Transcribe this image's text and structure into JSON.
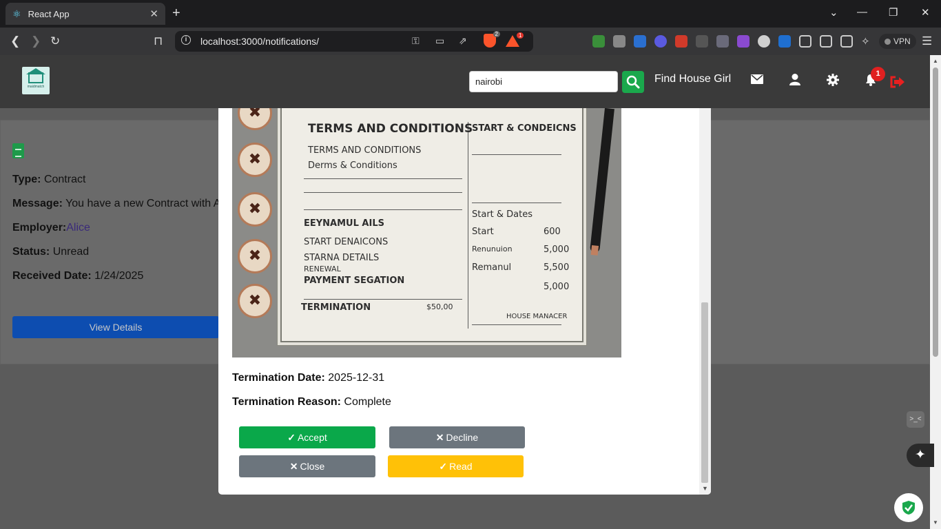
{
  "browser": {
    "tab_title": "React App",
    "url": "localhost:3000/notifications/",
    "brave_shield_count": "2",
    "rewards_count": "1",
    "vpn_label": "VPN"
  },
  "nav": {
    "logo_text": "maidmatch",
    "search_value": "nairobi",
    "find_link": "Find House Girl",
    "notification_count": "1"
  },
  "notification": {
    "type_label": "Type:",
    "type_value": "Contract",
    "message_label": "Message:",
    "message_value": "You have a new Contract with Al",
    "employer_label": "Employer:",
    "employer_value": "Alice",
    "status_label": "Status:",
    "status_value": "Unread",
    "date_label": "Received Date:",
    "date_value": "1/24/2025",
    "view_button": "View Details"
  },
  "contract_image": {
    "heading_left": "TERMS AND CONDITIONS",
    "heading_right": "START & CONDEICNS",
    "left_lines": [
      "TERMS AND CONDITIONS",
      "Derms & Conditions",
      "EEYNAMUL AILS",
      "START DENAICONS",
      "STARNA DETAILS",
      "RENEWAL",
      "PAYMENT SEGATION",
      "TERMINATION"
    ],
    "right_lines": [
      "Start & Dates",
      "Start",
      "Renunuion",
      "Remanul",
      "HOUSE MANACER"
    ],
    "right_values": [
      "600",
      "5,000",
      "5,500",
      "5,000"
    ],
    "termination_amount": "$50,00"
  },
  "modal": {
    "termination_date_label": "Termination Date:",
    "termination_date_value": "2025-12-31",
    "termination_reason_label": "Termination Reason:",
    "termination_reason_value": "Complete",
    "accept_label": "Accept",
    "decline_label": "Decline",
    "close_label": "Close",
    "read_label": "Read"
  },
  "colors": {
    "accept": "#0aa84a",
    "decline": "#6c757d",
    "read": "#ffc107",
    "view_details": "#0d4db0",
    "badge": "#e02020"
  }
}
